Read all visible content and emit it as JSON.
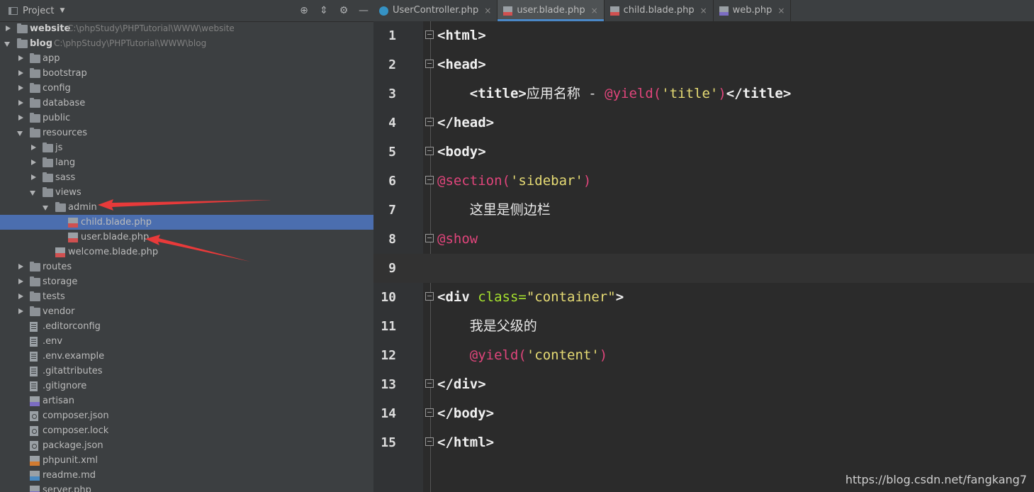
{
  "project_panel": {
    "title": "Project",
    "tree": [
      {
        "label": "website",
        "path": "C:\\phpStudy\\PHPTutorial\\WWW\\website",
        "type": "root",
        "state": "collapsed"
      },
      {
        "label": "blog",
        "path": "C:\\phpStudy\\PHPTutorial\\WWW\\blog",
        "type": "root",
        "state": "expanded"
      },
      {
        "label": "app",
        "type": "folder",
        "state": "collapsed"
      },
      {
        "label": "bootstrap",
        "type": "folder",
        "state": "collapsed"
      },
      {
        "label": "config",
        "type": "folder",
        "state": "collapsed"
      },
      {
        "label": "database",
        "type": "folder",
        "state": "collapsed"
      },
      {
        "label": "public",
        "type": "folder",
        "state": "collapsed"
      },
      {
        "label": "resources",
        "type": "folder",
        "state": "expanded"
      },
      {
        "label": "js",
        "type": "folder",
        "state": "collapsed"
      },
      {
        "label": "lang",
        "type": "folder",
        "state": "collapsed"
      },
      {
        "label": "sass",
        "type": "folder",
        "state": "collapsed"
      },
      {
        "label": "views",
        "type": "folder",
        "state": "expanded"
      },
      {
        "label": "admin",
        "type": "folder",
        "state": "expanded"
      },
      {
        "label": "child.blade.php",
        "type": "blade",
        "selected": true
      },
      {
        "label": "user.blade.php",
        "type": "blade"
      },
      {
        "label": "welcome.blade.php",
        "type": "blade"
      },
      {
        "label": "routes",
        "type": "folder",
        "state": "collapsed"
      },
      {
        "label": "storage",
        "type": "folder",
        "state": "collapsed"
      },
      {
        "label": "tests",
        "type": "folder",
        "state": "collapsed"
      },
      {
        "label": "vendor",
        "type": "folder",
        "state": "collapsed"
      },
      {
        "label": ".editorconfig",
        "type": "file"
      },
      {
        "label": ".env",
        "type": "file"
      },
      {
        "label": ".env.example",
        "type": "file"
      },
      {
        "label": ".gitattributes",
        "type": "file"
      },
      {
        "label": ".gitignore",
        "type": "file"
      },
      {
        "label": "artisan",
        "type": "php"
      },
      {
        "label": "composer.json",
        "type": "json"
      },
      {
        "label": "composer.lock",
        "type": "json"
      },
      {
        "label": "package.json",
        "type": "json"
      },
      {
        "label": "phpunit.xml",
        "type": "xml"
      },
      {
        "label": "readme.md",
        "type": "md"
      },
      {
        "label": "server.php",
        "type": "php"
      }
    ]
  },
  "tabs": [
    {
      "label": "UserController.php",
      "icon": "php-class-icon",
      "active": false
    },
    {
      "label": "user.blade.php",
      "icon": "blade-file-icon",
      "active": true
    },
    {
      "label": "child.blade.php",
      "icon": "blade-file-icon",
      "active": false
    },
    {
      "label": "web.php",
      "icon": "php-file-icon",
      "active": false
    }
  ],
  "tab_close_glyph": "×",
  "code_lines": [
    {
      "n": "1",
      "parts": [
        {
          "t": "<html>",
          "c": "tag"
        }
      ]
    },
    {
      "n": "2",
      "parts": [
        {
          "t": "<head>",
          "c": "tag"
        }
      ]
    },
    {
      "n": "3",
      "parts": [
        {
          "t": "    <title>",
          "c": "tag"
        },
        {
          "t": "应用名称 - ",
          "c": "plain"
        },
        {
          "t": "@yield(",
          "c": "dir"
        },
        {
          "t": "'title'",
          "c": "str"
        },
        {
          "t": ")",
          "c": "dir"
        },
        {
          "t": "</title>",
          "c": "tag"
        }
      ]
    },
    {
      "n": "4",
      "parts": [
        {
          "t": "</head>",
          "c": "tag"
        }
      ]
    },
    {
      "n": "5",
      "parts": [
        {
          "t": "<body>",
          "c": "tag"
        }
      ]
    },
    {
      "n": "6",
      "parts": [
        {
          "t": "@section(",
          "c": "dir"
        },
        {
          "t": "'sidebar'",
          "c": "str"
        },
        {
          "t": ")",
          "c": "dir"
        }
      ]
    },
    {
      "n": "7",
      "parts": [
        {
          "t": "    这里是侧边栏",
          "c": "plain"
        }
      ]
    },
    {
      "n": "8",
      "parts": [
        {
          "t": "@show",
          "c": "dir"
        }
      ]
    },
    {
      "n": "9",
      "parts": []
    },
    {
      "n": "10",
      "parts": [
        {
          "t": "<div ",
          "c": "tag"
        },
        {
          "t": "class=",
          "c": "attr"
        },
        {
          "t": "\"container\"",
          "c": "str"
        },
        {
          "t": ">",
          "c": "tag"
        }
      ]
    },
    {
      "n": "11",
      "parts": [
        {
          "t": "    我是父级的",
          "c": "plain"
        }
      ]
    },
    {
      "n": "12",
      "parts": [
        {
          "t": "    @yield(",
          "c": "dir"
        },
        {
          "t": "'content'",
          "c": "str"
        },
        {
          "t": ")",
          "c": "dir"
        }
      ]
    },
    {
      "n": "13",
      "parts": [
        {
          "t": "</div>",
          "c": "tag"
        }
      ]
    },
    {
      "n": "14",
      "parts": [
        {
          "t": "</body>",
          "c": "tag"
        }
      ]
    },
    {
      "n": "15",
      "parts": [
        {
          "t": "</html>",
          "c": "tag"
        }
      ]
    }
  ],
  "current_line": "9",
  "watermark": "https://blog.csdn.net/fangkang7",
  "colors": {
    "panel_bg": "#3c3f41",
    "editor_bg": "#2b2b2b",
    "selection": "#4b6eaf",
    "directive": "#e0457b",
    "string": "#e6db74",
    "attribute": "#a6e22e",
    "annotation_arrow": "#e83a3a"
  }
}
